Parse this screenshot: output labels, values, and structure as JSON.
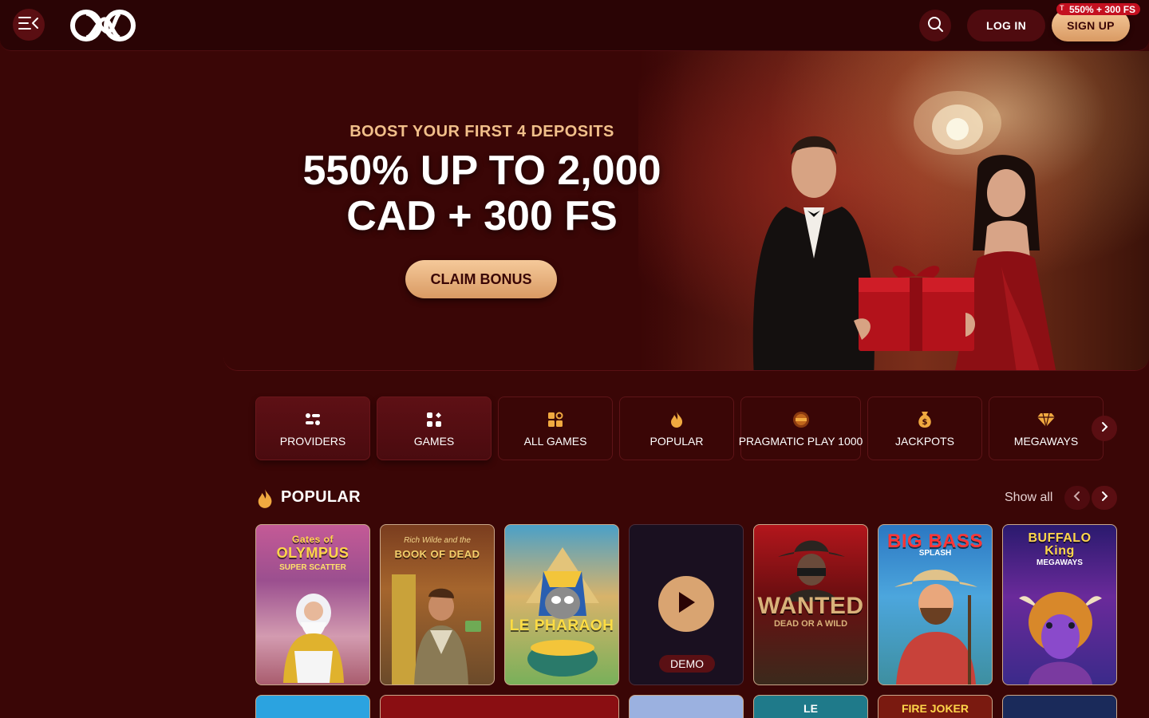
{
  "header": {
    "login_label": "LOG IN",
    "signup_label": "SIGN UP",
    "signup_badge": "550% + 300 FS",
    "signup_badge_prefix": "T"
  },
  "hero": {
    "subtitle": "BOOST YOUR FIRST 4 DEPOSITS",
    "title_line1": "550% UP TO 2,000",
    "title_line2": "CAD + 300 FS",
    "cta": "CLAIM BONUS"
  },
  "categories": [
    {
      "label": "PROVIDERS",
      "icon": "providers-icon",
      "active": true
    },
    {
      "label": "GAMES",
      "icon": "games-grid-icon",
      "active": true
    },
    {
      "label": "ALL GAMES",
      "icon": "all-games-icon",
      "active": false
    },
    {
      "label": "POPULAR",
      "icon": "flame-icon",
      "active": false
    },
    {
      "label": "PRAGMATIC PLAY 1000",
      "icon": "drops-wins-icon",
      "active": false
    },
    {
      "label": "JACKPOTS",
      "icon": "money-bag-icon",
      "active": false
    },
    {
      "label": "MEGAWAYS",
      "icon": "diamond-icon",
      "active": false
    }
  ],
  "popular": {
    "title": "POPULAR",
    "show_all": "Show all",
    "games": [
      {
        "name_line1": "Gates of",
        "name_line2": "OLYMPUS",
        "sub": "SUPER SCATTER"
      },
      {
        "name_line1": "BOOK OF DEAD",
        "name_line2": "",
        "sub": "Rich Wilde and the"
      },
      {
        "name_line1": "LE PHARAOH",
        "name_line2": "",
        "sub": ""
      },
      {
        "name_line1": "",
        "name_line2": "",
        "sub": "",
        "demo": "DEMO"
      },
      {
        "name_line1": "WANTED",
        "name_line2": "",
        "sub": "DEAD OR A WILD"
      },
      {
        "name_line1": "BIG BASS",
        "name_line2": "",
        "sub": "SPLASH"
      },
      {
        "name_line1": "BUFFALO",
        "name_line2": "King",
        "sub": "MEGAWAYS"
      }
    ],
    "row2": [
      {
        "name": ""
      },
      {
        "name": ""
      },
      {
        "name": ""
      },
      {
        "name": "LE"
      },
      {
        "name": "FIRE JOKER"
      },
      {
        "name": ""
      }
    ]
  },
  "colors": {
    "background": "#3a0606",
    "header": "#2a0405",
    "accent_gold": "#f1bf8a",
    "button_gold": "#d99a63",
    "badge_red": "#c41020"
  }
}
